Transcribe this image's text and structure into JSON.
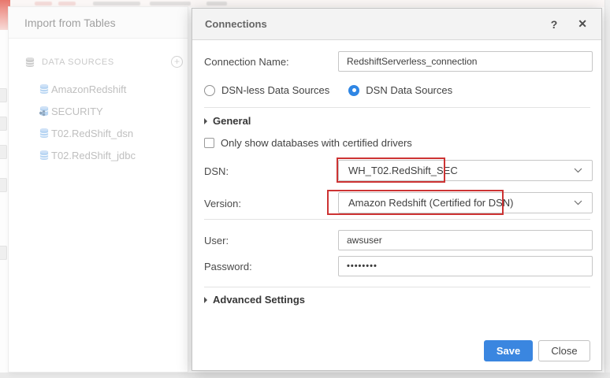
{
  "background": {
    "panel_title": "Import from Tables",
    "data_sources_header": "DATA SOURCES",
    "add_button_glyph": "+",
    "items": [
      {
        "label": "AmazonRedshift",
        "icon": "database-icon"
      },
      {
        "label": "SECURITY",
        "icon": "database-share-icon"
      },
      {
        "label": "T02.RedShift_dsn",
        "icon": "database-icon"
      },
      {
        "label": "T02.RedShift_jdbc",
        "icon": "database-icon"
      }
    ]
  },
  "dialog": {
    "title": "Connections",
    "help_label": "?",
    "close_label": "✕",
    "fields": {
      "connection_name": {
        "label": "Connection Name:",
        "value": "RedshiftServerless_connection"
      },
      "radio_dsnless": {
        "label": "DSN-less Data Sources",
        "selected": false
      },
      "radio_dsn": {
        "label": "DSN Data Sources",
        "selected": true
      },
      "general_section": "General",
      "certified_checkbox": {
        "label": "Only show databases with certified drivers",
        "checked": false
      },
      "dsn": {
        "label": "DSN:",
        "value": "WH_T02.RedShift_SEC"
      },
      "version": {
        "label": "Version:",
        "value": "Amazon Redshift (Certified for DSN)"
      },
      "user": {
        "label": "User:",
        "value": "awsuser"
      },
      "password": {
        "label": "Password:",
        "value": "••••••••"
      },
      "advanced_section": "Advanced Settings"
    },
    "buttons": {
      "save": "Save",
      "close": "Close"
    },
    "colors": {
      "accent": "#3a86e0",
      "annotation": "#cd3333",
      "selected_radio": "#2f86e4"
    }
  }
}
